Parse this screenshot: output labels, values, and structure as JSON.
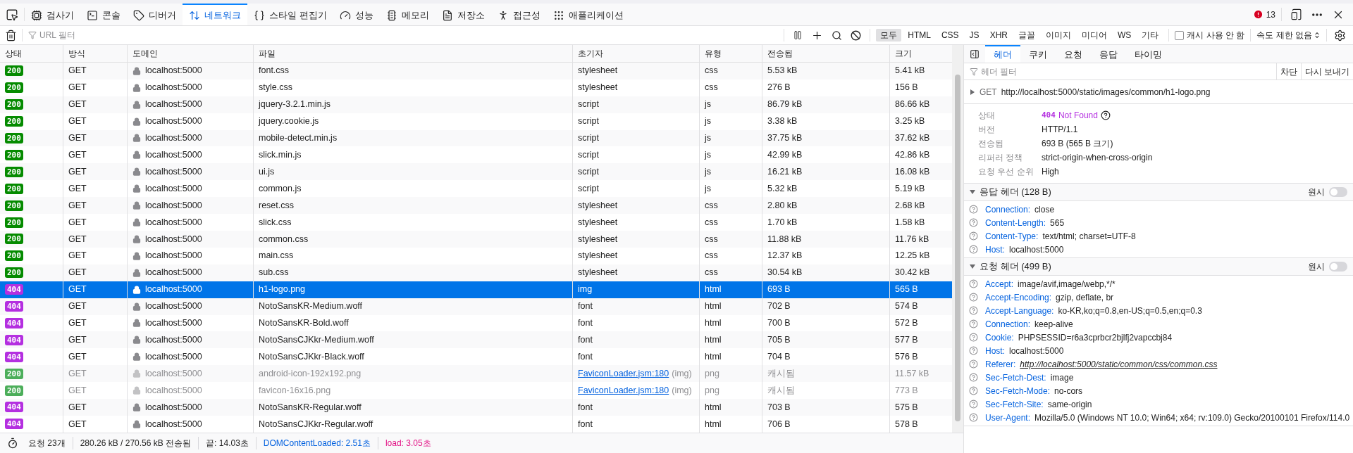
{
  "toolbar": {
    "tabs": [
      {
        "label": "검사기",
        "selected": false
      },
      {
        "label": "콘솔",
        "selected": false
      },
      {
        "label": "디버거",
        "selected": false
      },
      {
        "label": "네트워크",
        "selected": true
      },
      {
        "label": "스타일 편집기",
        "selected": false
      },
      {
        "label": "성능",
        "selected": false
      },
      {
        "label": "메모리",
        "selected": false
      },
      {
        "label": "저장소",
        "selected": false
      },
      {
        "label": "접근성",
        "selected": false
      },
      {
        "label": "애플리케이션",
        "selected": false
      }
    ],
    "error_count": "13"
  },
  "filter_bar": {
    "placeholder": "URL 필터",
    "type_filters": [
      {
        "label": "모두",
        "selected": true
      },
      {
        "label": "HTML",
        "selected": false
      },
      {
        "label": "CSS",
        "selected": false
      },
      {
        "label": "JS",
        "selected": false
      },
      {
        "label": "XHR",
        "selected": false
      },
      {
        "label": "글꼴",
        "selected": false
      },
      {
        "label": "이미지",
        "selected": false
      },
      {
        "label": "미디어",
        "selected": false
      },
      {
        "label": "WS",
        "selected": false
      },
      {
        "label": "기타",
        "selected": false
      }
    ],
    "disable_cache": {
      "label": "캐시 사용 안 함",
      "checked": false
    },
    "throttling": "속도 제한 없음"
  },
  "table": {
    "columns": [
      "상태",
      "방식",
      "도메인",
      "파일",
      "초기자",
      "유형",
      "전송됨",
      "크기"
    ],
    "rows": [
      {
        "status": "200",
        "color": "#058b00",
        "method": "GET",
        "domain": "localhost:5000",
        "file": "font.css",
        "initiator": {
          "text": "stylesheet",
          "link": false
        },
        "type": "css",
        "transferred": "5.53 kB",
        "size": "5.41 kB",
        "cached": false,
        "selected": false
      },
      {
        "status": "200",
        "color": "#058b00",
        "method": "GET",
        "domain": "localhost:5000",
        "file": "style.css",
        "initiator": {
          "text": "stylesheet",
          "link": false
        },
        "type": "css",
        "transferred": "276 B",
        "size": "156 B",
        "cached": false,
        "selected": false
      },
      {
        "status": "200",
        "color": "#058b00",
        "method": "GET",
        "domain": "localhost:5000",
        "file": "jquery-3.2.1.min.js",
        "initiator": {
          "text": "script",
          "link": false
        },
        "type": "js",
        "transferred": "86.79 kB",
        "size": "86.66 kB",
        "cached": false,
        "selected": false
      },
      {
        "status": "200",
        "color": "#058b00",
        "method": "GET",
        "domain": "localhost:5000",
        "file": "jquery.cookie.js",
        "initiator": {
          "text": "script",
          "link": false
        },
        "type": "js",
        "transferred": "3.38 kB",
        "size": "3.25 kB",
        "cached": false,
        "selected": false
      },
      {
        "status": "200",
        "color": "#058b00",
        "method": "GET",
        "domain": "localhost:5000",
        "file": "mobile-detect.min.js",
        "initiator": {
          "text": "script",
          "link": false
        },
        "type": "js",
        "transferred": "37.75 kB",
        "size": "37.62 kB",
        "cached": false,
        "selected": false
      },
      {
        "status": "200",
        "color": "#058b00",
        "method": "GET",
        "domain": "localhost:5000",
        "file": "slick.min.js",
        "initiator": {
          "text": "script",
          "link": false
        },
        "type": "js",
        "transferred": "42.99 kB",
        "size": "42.86 kB",
        "cached": false,
        "selected": false
      },
      {
        "status": "200",
        "color": "#058b00",
        "method": "GET",
        "domain": "localhost:5000",
        "file": "ui.js",
        "initiator": {
          "text": "script",
          "link": false
        },
        "type": "js",
        "transferred": "16.21 kB",
        "size": "16.08 kB",
        "cached": false,
        "selected": false
      },
      {
        "status": "200",
        "color": "#058b00",
        "method": "GET",
        "domain": "localhost:5000",
        "file": "common.js",
        "initiator": {
          "text": "script",
          "link": false
        },
        "type": "js",
        "transferred": "5.32 kB",
        "size": "5.19 kB",
        "cached": false,
        "selected": false
      },
      {
        "status": "200",
        "color": "#058b00",
        "method": "GET",
        "domain": "localhost:5000",
        "file": "reset.css",
        "initiator": {
          "text": "stylesheet",
          "link": false
        },
        "type": "css",
        "transferred": "2.80 kB",
        "size": "2.68 kB",
        "cached": false,
        "selected": false
      },
      {
        "status": "200",
        "color": "#058b00",
        "method": "GET",
        "domain": "localhost:5000",
        "file": "slick.css",
        "initiator": {
          "text": "stylesheet",
          "link": false
        },
        "type": "css",
        "transferred": "1.70 kB",
        "size": "1.58 kB",
        "cached": false,
        "selected": false
      },
      {
        "status": "200",
        "color": "#058b00",
        "method": "GET",
        "domain": "localhost:5000",
        "file": "common.css",
        "initiator": {
          "text": "stylesheet",
          "link": false
        },
        "type": "css",
        "transferred": "11.88 kB",
        "size": "11.76 kB",
        "cached": false,
        "selected": false
      },
      {
        "status": "200",
        "color": "#058b00",
        "method": "GET",
        "domain": "localhost:5000",
        "file": "main.css",
        "initiator": {
          "text": "stylesheet",
          "link": false
        },
        "type": "css",
        "transferred": "12.37 kB",
        "size": "12.25 kB",
        "cached": false,
        "selected": false
      },
      {
        "status": "200",
        "color": "#058b00",
        "method": "GET",
        "domain": "localhost:5000",
        "file": "sub.css",
        "initiator": {
          "text": "stylesheet",
          "link": false
        },
        "type": "css",
        "transferred": "30.54 kB",
        "size": "30.42 kB",
        "cached": false,
        "selected": false
      },
      {
        "status": "404",
        "color": "#b42fe0",
        "method": "GET",
        "domain": "localhost:5000",
        "file": "h1-logo.png",
        "initiator": {
          "text": "img",
          "link": false
        },
        "type": "html",
        "transferred": "693 B",
        "size": "565 B",
        "cached": false,
        "selected": true
      },
      {
        "status": "404",
        "color": "#b42fe0",
        "method": "GET",
        "domain": "localhost:5000",
        "file": "NotoSansKR-Medium.woff",
        "initiator": {
          "text": "font",
          "link": false
        },
        "type": "html",
        "transferred": "702 B",
        "size": "574 B",
        "cached": false,
        "selected": false
      },
      {
        "status": "404",
        "color": "#b42fe0",
        "method": "GET",
        "domain": "localhost:5000",
        "file": "NotoSansKR-Bold.woff",
        "initiator": {
          "text": "font",
          "link": false
        },
        "type": "html",
        "transferred": "700 B",
        "size": "572 B",
        "cached": false,
        "selected": false
      },
      {
        "status": "404",
        "color": "#b42fe0",
        "method": "GET",
        "domain": "localhost:5000",
        "file": "NotoSansCJKkr-Medium.woff",
        "initiator": {
          "text": "font",
          "link": false
        },
        "type": "html",
        "transferred": "705 B",
        "size": "577 B",
        "cached": false,
        "selected": false
      },
      {
        "status": "404",
        "color": "#b42fe0",
        "method": "GET",
        "domain": "localhost:5000",
        "file": "NotoSansCJKkr-Black.woff",
        "initiator": {
          "text": "font",
          "link": false
        },
        "type": "html",
        "transferred": "704 B",
        "size": "576 B",
        "cached": false,
        "selected": false
      },
      {
        "status": "200",
        "color": "#4cae5a",
        "method": "GET",
        "domain": "localhost:5000",
        "file": "android-icon-192x192.png",
        "initiator": {
          "text": "FaviconLoader.jsm:180",
          "link": true,
          "note": "(img)"
        },
        "type": "png",
        "transferred": "캐시됨",
        "size": "11.57 kB",
        "cached": true,
        "selected": false
      },
      {
        "status": "200",
        "color": "#4cae5a",
        "method": "GET",
        "domain": "localhost:5000",
        "file": "favicon-16x16.png",
        "initiator": {
          "text": "FaviconLoader.jsm:180",
          "link": true,
          "note": "(img)"
        },
        "type": "png",
        "transferred": "캐시됨",
        "size": "773 B",
        "cached": true,
        "selected": false
      },
      {
        "status": "404",
        "color": "#b42fe0",
        "method": "GET",
        "domain": "localhost:5000",
        "file": "NotoSansKR-Regular.woff",
        "initiator": {
          "text": "font",
          "link": false
        },
        "type": "html",
        "transferred": "703 B",
        "size": "575 B",
        "cached": false,
        "selected": false
      },
      {
        "status": "404",
        "color": "#b42fe0",
        "method": "GET",
        "domain": "localhost:5000",
        "file": "NotoSansCJKkr-Regular.woff",
        "initiator": {
          "text": "font",
          "link": false
        },
        "type": "html",
        "transferred": "706 B",
        "size": "578 B",
        "cached": false,
        "selected": false
      }
    ]
  },
  "status_bar": {
    "requests": "요청 23개",
    "transferred": "280.26 kB / 270.56 kB 전송됨",
    "finish": "끝: 14.03초",
    "dom_content_loaded": "DOMContentLoaded: 2.51초",
    "load": "load: 3.05초"
  },
  "details": {
    "tabs": [
      {
        "label": "헤더",
        "selected": true
      },
      {
        "label": "쿠키",
        "selected": false
      },
      {
        "label": "요청",
        "selected": false
      },
      {
        "label": "응답",
        "selected": false
      },
      {
        "label": "타이밍",
        "selected": false
      }
    ],
    "filter_placeholder": "헤더 필터",
    "actions": [
      "차단",
      "다시 보내기"
    ],
    "request": {
      "expanded": false,
      "method": "GET",
      "url": "http://localhost:5000/static/images/common/h1-logo.png"
    },
    "summary": [
      {
        "kind": "status",
        "label": "상태",
        "code": "404",
        "value": "Not Found"
      },
      {
        "kind": "text",
        "label": "버전",
        "value": "HTTP/1.1"
      },
      {
        "kind": "text",
        "label": "전송됨",
        "value": "693 B (565 B 크기)"
      },
      {
        "kind": "text",
        "label": "리퍼러 정책",
        "value": "strict-origin-when-cross-origin"
      },
      {
        "kind": "text",
        "label": "요청 우선 순위",
        "value": "High"
      }
    ],
    "sections": [
      {
        "title": "응답 헤더 (128 B)",
        "expanded": true,
        "raw_label": "원시",
        "raw": false,
        "headers": [
          {
            "kind": "text",
            "name": "Connection:",
            "value": "close"
          },
          {
            "kind": "text",
            "name": "Content-Length:",
            "value": "565"
          },
          {
            "kind": "text",
            "name": "Content-Type:",
            "value": "text/html; charset=UTF-8"
          },
          {
            "kind": "text",
            "name": "Host:",
            "value": "localhost:5000"
          }
        ]
      },
      {
        "title": "요청 헤더 (499 B)",
        "expanded": true,
        "raw_label": "원시",
        "raw": false,
        "headers": [
          {
            "kind": "text",
            "name": "Accept:",
            "value": "image/avif,image/webp,*/*"
          },
          {
            "kind": "text",
            "name": "Accept-Encoding:",
            "value": "gzip, deflate, br"
          },
          {
            "kind": "text",
            "name": "Accept-Language:",
            "value": "ko-KR,ko;q=0.8,en-US;q=0.5,en;q=0.3"
          },
          {
            "kind": "text",
            "name": "Connection:",
            "value": "keep-alive"
          },
          {
            "kind": "text",
            "name": "Cookie:",
            "value": "PHPSESSID=r6a3cprbcr2bjlfj2vapccbj84"
          },
          {
            "kind": "text",
            "name": "Host:",
            "value": "localhost:5000"
          },
          {
            "kind": "link",
            "name": "Referer:",
            "value": "http://localhost:5000/static/common/css/common.css"
          },
          {
            "kind": "text",
            "name": "Sec-Fetch-Dest:",
            "value": "image"
          },
          {
            "kind": "text",
            "name": "Sec-Fetch-Mode:",
            "value": "no-cors"
          },
          {
            "kind": "text",
            "name": "Sec-Fetch-Site:",
            "value": "same-origin"
          },
          {
            "kind": "text",
            "name": "User-Agent:",
            "value": "Mozilla/5.0 (Windows NT 10.0; Win64; x64; rv:109.0) Gecko/20100101 Firefox/114.0"
          }
        ]
      }
    ]
  }
}
